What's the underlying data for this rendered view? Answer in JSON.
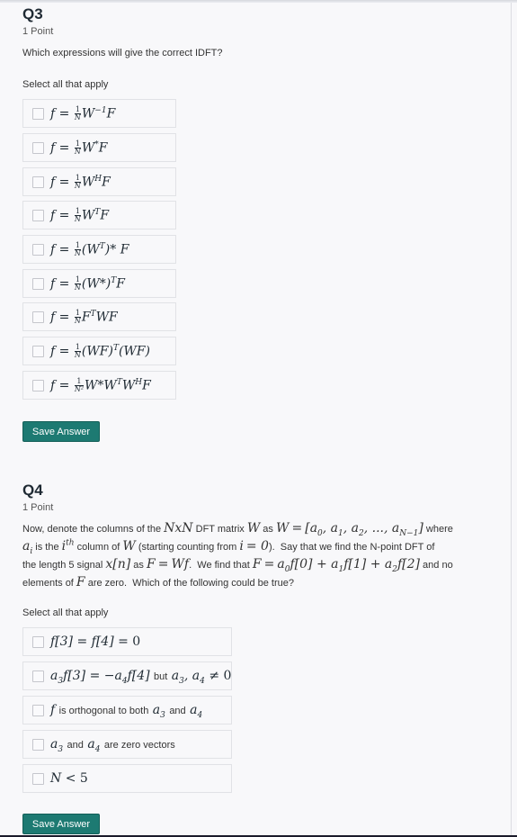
{
  "q3": {
    "title": "Q3",
    "points": "1 Point",
    "prompt": "Which expressions will give the correct IDFT?",
    "select_hint": "Select all that apply",
    "options": [
      {
        "lhs": "f = ",
        "num": "1",
        "den": "N",
        "rhs": "W",
        "sup": "−1",
        "tail": "F"
      },
      {
        "lhs": "f = ",
        "num": "1",
        "den": "N",
        "rhs": "W",
        "sup": "*",
        "tail": "F"
      },
      {
        "lhs": "f = ",
        "num": "1",
        "den": "N",
        "rhs": "W",
        "sup": "H",
        "tail": "F"
      },
      {
        "lhs": "f = ",
        "num": "1",
        "den": "N",
        "rhs": "W",
        "sup": "T",
        "tail": "F"
      },
      {
        "lhs": "f = ",
        "num": "1",
        "den": "N",
        "rhs": "(W",
        "sup": "T",
        "tail": ")* F"
      },
      {
        "lhs": "f = ",
        "num": "1",
        "den": "N",
        "rhs": "(W*)",
        "sup": "T",
        "tail": "F"
      },
      {
        "lhs": "f = ",
        "num": "1",
        "den": "N",
        "rhs": "F",
        "sup": "T",
        "tail": "WF"
      },
      {
        "lhs": "f = ",
        "num": "1",
        "den": "N",
        "rhs": "(WF)",
        "sup": "T",
        "tail": "(WF)"
      },
      {
        "lhs": "f = ",
        "num": "1",
        "den": "N²",
        "rhs": "W*W",
        "sup": "T",
        "tail": "W",
        "sup2": "H",
        "tail2": "F"
      }
    ],
    "save_label": "Save Answer"
  },
  "q4": {
    "title": "Q4",
    "points": "1 Point",
    "prompt_lines": [
      "Now, denote the columns of the NxN DFT matrix W as W = [a₀, a₁, a₂, ..., a_{N−1}] where",
      "aᵢ is the iᵗʰ column of W (starting counting from i = 0). Say that we find the N-point DFT of",
      "the length 5 signal x[n] as F = Wf. We find that F = a₀f[0] + a₁f[1] + a₂f[2] and no",
      "elements of F are zero. Which of the following could be true?"
    ],
    "select_hint": "Select all that apply",
    "options": [
      "f[3] = f[4] = 0",
      "a₃f[3] = −a₄f[4] but a₃, a₄ ≠ 0",
      "f is orthogonal to both a₃ and a₄",
      "a₃ and a₄ are zero vectors",
      "N < 5"
    ],
    "save_label": "Save Answer"
  },
  "colors": {
    "button_bg": "#1d7a72",
    "background": "#f8f8fa",
    "option_border": "#e1e2e6"
  }
}
